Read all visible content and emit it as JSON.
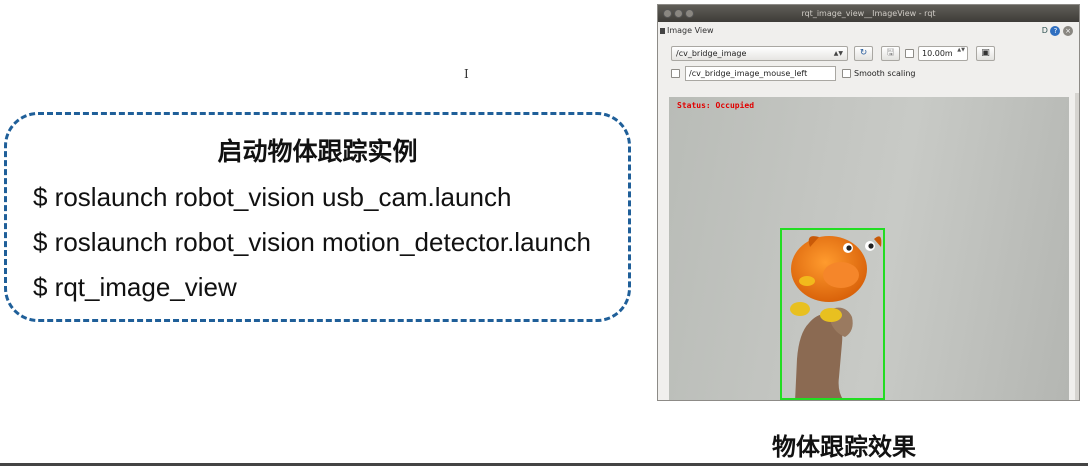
{
  "commands": {
    "title": "启动物体跟踪实例",
    "lines": [
      "$ roslaunch robot_vision usb_cam.launch",
      "$ roslaunch robot_vision motion_detector.launch",
      "$ rqt_image_view"
    ]
  },
  "cursor_glyph": "I",
  "window": {
    "title": "rqt_image_view__ImageView - rqt",
    "dock_title": "Image View",
    "dock_controls": "D",
    "help_glyph": "?",
    "close_glyph": "×",
    "topic": "/cv_bridge_image",
    "topic_arrow": "▲▼",
    "refresh_glyph": "↻",
    "save_glyph": "🖫",
    "zoom_value": "10.00m",
    "zoom_spin": "▲▼",
    "monitor_glyph": "▣",
    "mouse_topic": "/cv_bridge_image_mouse_left",
    "smooth_scaling_label": "Smooth scaling",
    "status_text": "Status: Occupied"
  },
  "caption": "物体跟踪效果",
  "colors": {
    "box_border": "#1f5f99",
    "status_text": "#e00000",
    "bbox": "#22dd22",
    "titlebar": "#4a4844",
    "toy": "#f07a10"
  }
}
